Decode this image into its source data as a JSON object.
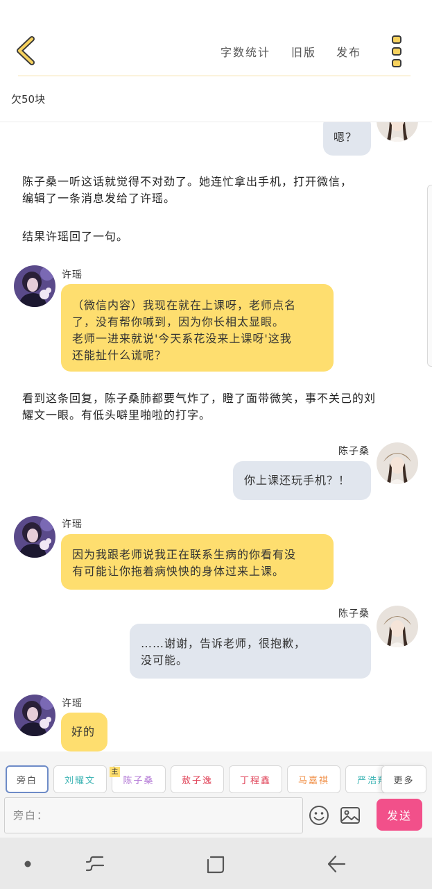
{
  "header": {
    "word_count_label": "字数统计",
    "old_version_label": "旧版",
    "publish_label": "发布",
    "story_title": "欠50块"
  },
  "content": {
    "partial_bubble_text": "嗯？",
    "narration_1": [
      "陈子桑一听这话就觉得不对劲了。她连忙拿出手机，打开微信，",
      "编辑了一条消息发给了许瑶。"
    ],
    "narration_2": "结果许瑶回了一句。",
    "msg_1": {
      "sender": "许瑶",
      "lines": [
        "（微信内容）我现在就在上课呀，老师点名",
        "了，没有帮你喊到，因为你长相太显眼。",
        "老师一进来就说'今天系花没来上课呀'这我",
        "还能扯什么谎呢？"
      ]
    },
    "narration_3": [
      "看到这条回复，陈子桑肺都要气炸了，瞪了面带微笑，事不关己的刘",
      "耀文一眼。有低头噼里啪啦的打字。"
    ],
    "msg_2": {
      "sender": "陈子桑",
      "text": "你上课还玩手机？！"
    },
    "msg_3": {
      "sender": "许瑶",
      "lines": [
        "因为我跟老师说我正在联系生病的你看有没",
        "有可能让你拖着病怏怏的身体过来上课。"
      ]
    },
    "msg_4": {
      "sender": "陈子桑",
      "lines": [
        "……谢谢，告诉老师，很抱歉，",
        "没可能。"
      ]
    },
    "msg_5": {
      "sender": "许瑶",
      "text": "好的"
    }
  },
  "characters": {
    "items": [
      {
        "label": "旁白",
        "color": "#555555"
      },
      {
        "label": "刘耀文",
        "color": "#3fb5b5"
      },
      {
        "label": "陈子桑",
        "color": "#b47ad6"
      },
      {
        "label": "敖子逸",
        "color": "#e0455a"
      },
      {
        "label": "丁程鑫",
        "color": "#e0455a"
      },
      {
        "label": "马嘉祺",
        "color": "#f0914a"
      },
      {
        "label": "严浩翔",
        "color": "#3fb5b5"
      }
    ],
    "main_badge": "主",
    "more_label": "更多"
  },
  "input": {
    "placeholder": "旁白："
  },
  "send_label": "发送",
  "colors": {
    "accent_yellow": "#fede6f",
    "bubble_gray": "#e1e6ee",
    "send_pink": "#f2508a",
    "back_yellow": "#f7d25e"
  },
  "icons": [
    "back-arrow-icon",
    "more-vertical-icon",
    "emoji-icon",
    "image-icon",
    "recent-apps-icon",
    "home-icon",
    "nav-back-icon"
  ]
}
